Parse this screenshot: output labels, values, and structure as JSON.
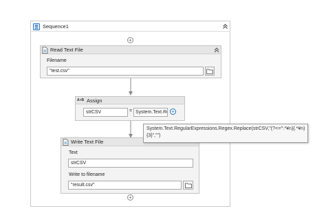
{
  "sequence": {
    "title": "Sequence1"
  },
  "read_text_file": {
    "title": "Read Text File",
    "filename_label": "Filename",
    "filename_value": "\"test.csv\""
  },
  "assign": {
    "title": "Assign",
    "badge": "A+B",
    "to_value": "strCSV",
    "equals": "=",
    "value_text": "System.Text.Re"
  },
  "tooltip": {
    "line1": "System.Text.RegularExpressions.Regex.Replace(strCSV,\"(?<=^.*¥n){.*¥n)",
    "line2": "{3}\",\"\")"
  },
  "write_text_file": {
    "title": "Write Text File",
    "text_label": "Text",
    "text_value": "strCSV",
    "write_label": "Write to filename",
    "write_value": "\"result.csv\""
  },
  "icons": [
    "sequence-icon",
    "collapse-icon",
    "add-activity-icon",
    "file-icon",
    "folder-icon",
    "plus-icon"
  ],
  "colors": {
    "accent": "#1e6fc2",
    "connector": "#8a8a8a"
  }
}
